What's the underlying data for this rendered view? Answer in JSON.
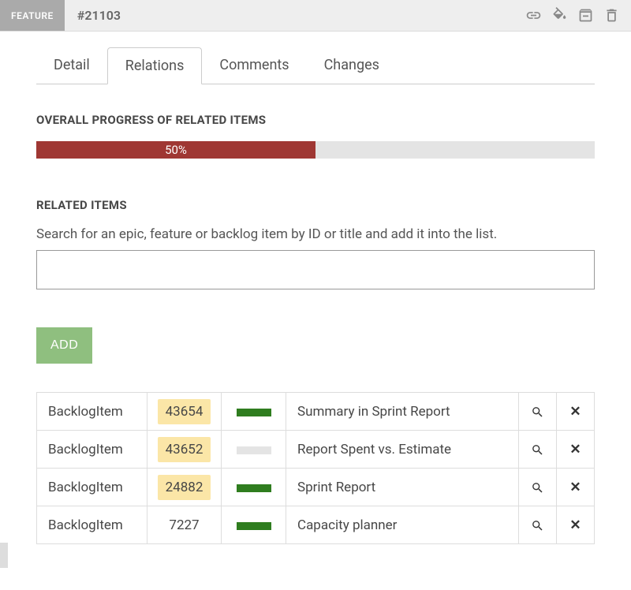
{
  "header": {
    "badge": "FEATURE",
    "issue_id": "#21103"
  },
  "tabs": [
    {
      "label": "Detail",
      "active": false
    },
    {
      "label": "Relations",
      "active": true
    },
    {
      "label": "Comments",
      "active": false
    },
    {
      "label": "Changes",
      "active": false
    }
  ],
  "progress_section": {
    "title": "OVERALL PROGRESS OF RELATED ITEMS",
    "percent": 50,
    "label": "50%"
  },
  "related_section": {
    "title": "RELATED ITEMS",
    "help_text": "Search for an epic, feature or backlog item by ID or title and add it into the list.",
    "search_value": "",
    "add_label": "ADD"
  },
  "related_items": [
    {
      "type": "BacklogItem",
      "id": "43654",
      "highlighted": true,
      "progress": 100,
      "title": "Summary in Sprint Report"
    },
    {
      "type": "BacklogItem",
      "id": "43652",
      "highlighted": true,
      "progress": 0,
      "title": "Report Spent vs. Estimate"
    },
    {
      "type": "BacklogItem",
      "id": "24882",
      "highlighted": true,
      "progress": 100,
      "title": "Sprint Report"
    },
    {
      "type": "BacklogItem",
      "id": "7227",
      "highlighted": false,
      "progress": 100,
      "title": "Capacity planner"
    }
  ]
}
